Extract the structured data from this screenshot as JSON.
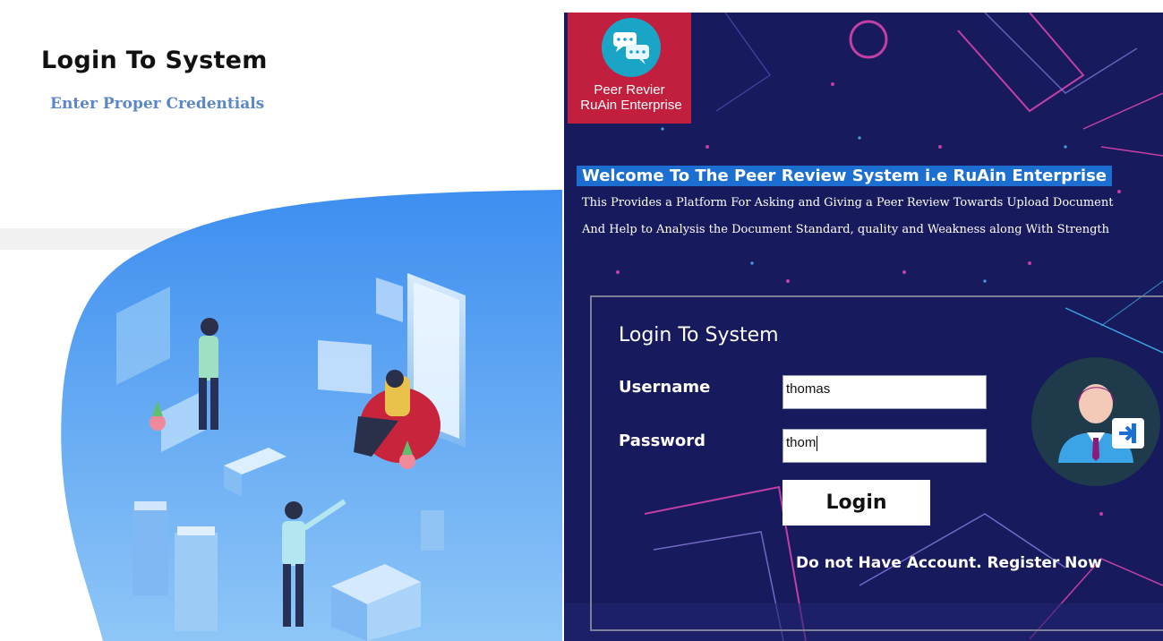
{
  "left": {
    "title": "Login To System",
    "subtitle": "Enter Proper Credentials"
  },
  "right": {
    "logo": {
      "icon": "chat-bubbles-icon",
      "line1": "Peer Revier",
      "line2": "RuAin Enterprise"
    },
    "welcome": "Welcome To The Peer Review System i.e RuAin Enterprise",
    "description": [
      "This Provides a Platform For Asking  and Giving a Peer Review  Towards Upload Document",
      "And Help to Analysis the Document Standard, quality and Weakness along With Strength"
    ],
    "login": {
      "title": "Login To System",
      "username_label": "Username",
      "username_value": "thomas",
      "password_label": "Password",
      "password_value": "thom",
      "button_label": "Login",
      "register_text": "Do not Have Account. Register Now",
      "avatar_icon": "user-login-icon"
    }
  },
  "colors": {
    "right_background": "#171a5c",
    "logo_background": "#c21f3f",
    "welcome_highlight": "#1c6fd1",
    "subtitle_blue": "#5b87c9"
  }
}
